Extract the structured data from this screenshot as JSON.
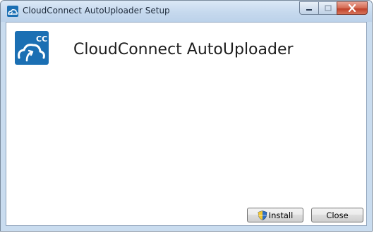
{
  "window": {
    "title": "CloudConnect AutoUploader Setup"
  },
  "main": {
    "product_title": "CloudConnect AutoUploader",
    "logo_text": "CC"
  },
  "buttons": {
    "install_label": "Install",
    "close_label": "Close"
  },
  "colors": {
    "logo_blue": "#1b6fb3",
    "close_red": "#c0412a"
  },
  "icons": {
    "app": "cloudconnect-app-icon",
    "logo": "cloudconnect-logo-icon",
    "install": "uac-shield-icon"
  }
}
